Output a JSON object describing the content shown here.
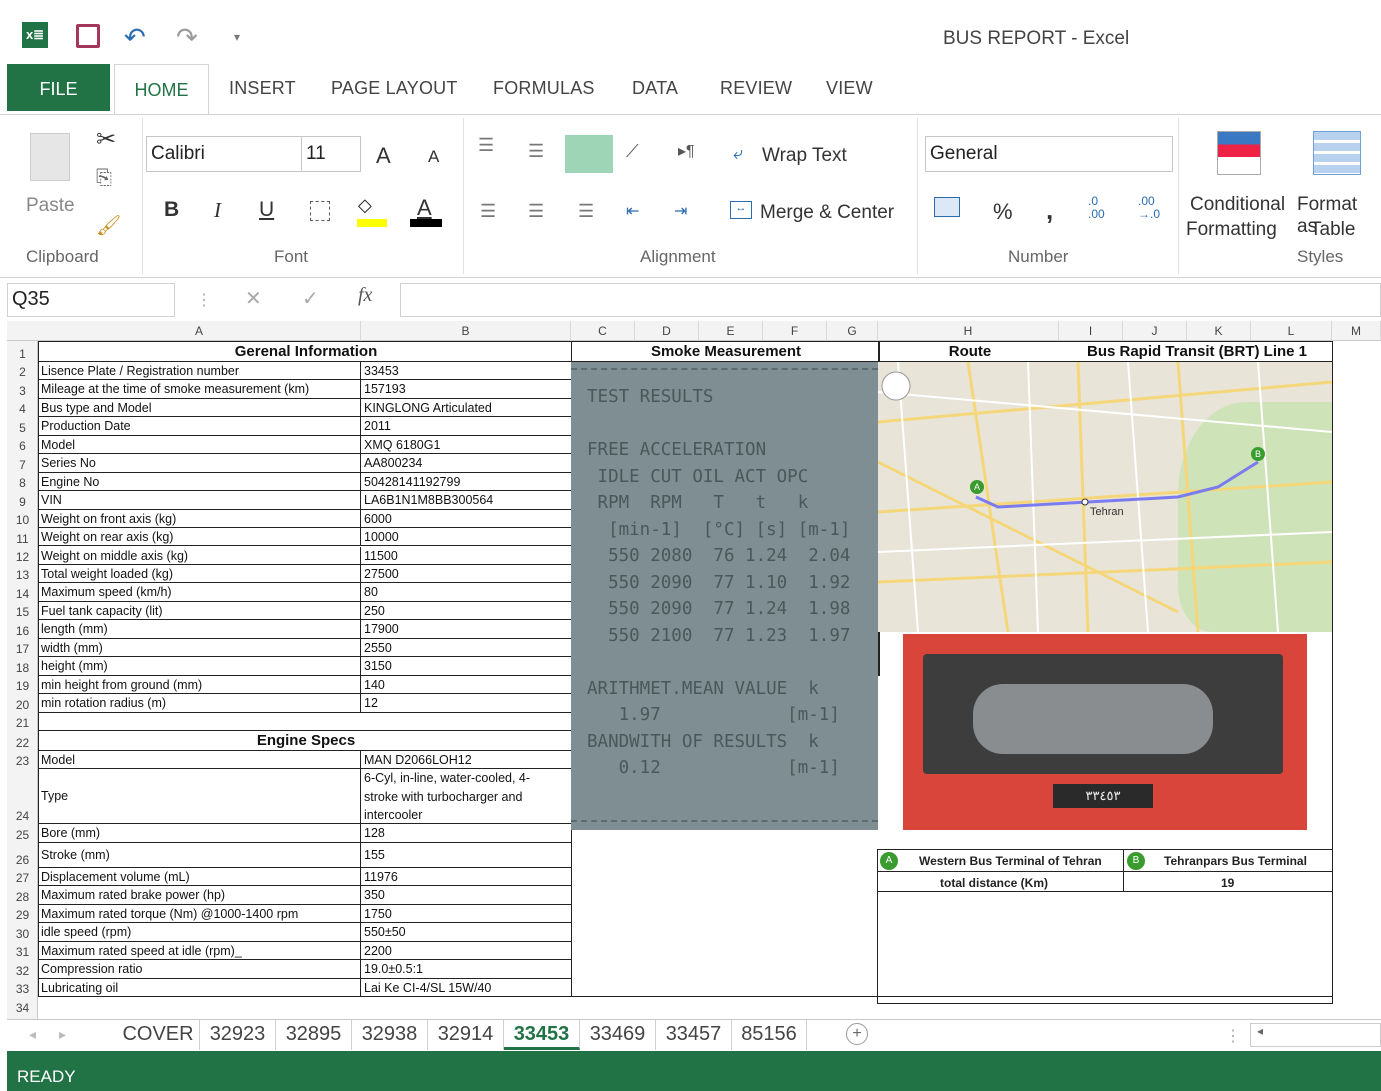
{
  "window": {
    "title": "BUS REPORT - Excel"
  },
  "ribbon_tabs": [
    "FILE",
    "HOME",
    "INSERT",
    "PAGE LAYOUT",
    "FORMULAS",
    "DATA",
    "REVIEW",
    "VIEW"
  ],
  "clipboard": {
    "paste": "Paste",
    "group": "Clipboard"
  },
  "font": {
    "name": "Calibri",
    "size": "11",
    "group": "Font",
    "bold": "B",
    "italic": "I",
    "underline": "U",
    "grow": "A",
    "shrink": "A",
    "color": "A"
  },
  "alignment": {
    "wrap": "Wrap Text",
    "merge": "Merge & Center",
    "group": "Alignment"
  },
  "number": {
    "format": "General",
    "percent": "%",
    "comma": ",",
    "inc": ".0\n.00",
    "dec": ".00\n→.0",
    "group": "Number"
  },
  "styles": {
    "cond1": "Conditional",
    "cond2": "Formatting",
    "fmt1": "Format as",
    "fmt2": "Table",
    "group": "Styles"
  },
  "formula_bar": {
    "name_box": "Q35",
    "fx": "fx",
    "formula": ""
  },
  "columns": [
    "A",
    "B",
    "C",
    "D",
    "E",
    "F",
    "G",
    "H",
    "I",
    "J",
    "K",
    "L",
    "M"
  ],
  "general": {
    "title": "Gerenal Information",
    "rows": [
      [
        "Lisence Plate / Registration number",
        "33453"
      ],
      [
        "Mileage at the time of smoke measurement (km)",
        "157193"
      ],
      [
        "Bus type and Model",
        "KINGLONG Articulated"
      ],
      [
        "Production Date",
        "2011"
      ],
      [
        "Model",
        "XMQ 6180G1"
      ],
      [
        "Series No",
        "AA800234"
      ],
      [
        "Engine No",
        "50428141192799"
      ],
      [
        "VIN",
        "LA6B1N1M8BB300564"
      ],
      [
        "Weight on front axis (kg)",
        "6000"
      ],
      [
        "Weight on rear axis (kg)",
        "10000"
      ],
      [
        "Weight on middle axis (kg)",
        "11500"
      ],
      [
        "Total weight loaded (kg)",
        "27500"
      ],
      [
        "Maximum speed (km/h)",
        "80"
      ],
      [
        "Fuel tank capacity (lit)",
        "250"
      ],
      [
        "length (mm)",
        "17900"
      ],
      [
        "width (mm)",
        "2550"
      ],
      [
        "height (mm)",
        "3150"
      ],
      [
        "min height from ground (mm)",
        "140"
      ],
      [
        "min rotation radius (m)",
        "12"
      ]
    ]
  },
  "engine": {
    "title": "Engine Specs",
    "model": [
      "Model",
      "MAN D2066LOH12"
    ],
    "type_label": "Type",
    "type_lines": [
      "6-Cyl, in-line, water-cooled, 4-",
      "stroke with turbocharger and",
      "intercooler"
    ],
    "rows": [
      [
        "Bore (mm)",
        "128"
      ],
      [
        "Stroke (mm)",
        "155"
      ],
      [
        "Displacement volume (mL)",
        "11976"
      ],
      [
        "Maximum rated brake power (hp)",
        "350"
      ],
      [
        "Maximum rated torque (Nm) @1000-1400 rpm",
        "1750"
      ],
      [
        "idle speed (rpm)",
        "550±50"
      ],
      [
        "Maximum rated speed at idle (rpm)_",
        "2200"
      ],
      [
        "Compression ratio",
        "19.0±0.5:1"
      ],
      [
        "Lubricating oil",
        "Lai Ke CI-4/SL 15W/40"
      ]
    ]
  },
  "smoke": {
    "title": "Smoke Measurement",
    "receipt": [
      "TEST RESULTS",
      "",
      "FREE ACCELERATION",
      " IDLE CUT OIL ACT OPC",
      " RPM  RPM   T   t   k",
      "  [min-1]  [°C] [s] [m-1]",
      "  550 2080  76 1.24  2.04",
      "  550 2090  77 1.10  1.92",
      "  550 2090  77 1.24  1.98",
      "  550 2100  77 1.23  1.97",
      "",
      "ARITHMET.MEAN VALUE  k",
      "   1.97            [m-1]",
      "BANDWITH OF RESULTS  k",
      "   0.12            [m-1]"
    ]
  },
  "route": {
    "title": "Route",
    "line": "Bus Rapid Transit (BRT) Line 1",
    "map_city": "Tehran",
    "start": "Western Bus Terminal of Tehran",
    "end": "Tehranpars Bus Terminal",
    "start_marker": "A",
    "end_marker": "B",
    "distance_label": "total distance (Km)",
    "distance": "19",
    "plate": "٣٣٤٥٣"
  },
  "sheet_tabs": [
    "COVER",
    "32923",
    "32895",
    "32938",
    "32914",
    "33453",
    "33469",
    "33457",
    "85156"
  ],
  "active_tab": "33453",
  "status": "READY",
  "colors": {
    "accent": "#217346"
  }
}
